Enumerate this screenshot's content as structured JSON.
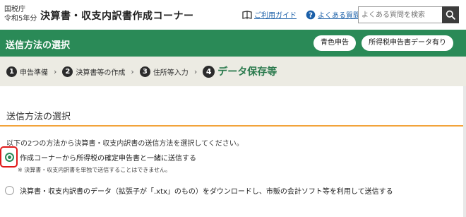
{
  "header": {
    "agency": "国税庁",
    "year": "令和5年分",
    "title": "決算書・収支内訳書作成コーナー",
    "guide_link": "ご利用ガイド",
    "faq_link": "よくある質問",
    "search_placeholder": "よくある質問を検索"
  },
  "green_bar": {
    "title": "送信方法の選択",
    "buttons": [
      "青色申告",
      "所得税申告書データ有り"
    ]
  },
  "steps": [
    {
      "num": "1",
      "label": "申告準備"
    },
    {
      "num": "2",
      "label": "決算書等の作成"
    },
    {
      "num": "3",
      "label": "住所等入力"
    },
    {
      "num": "4",
      "label": "データ保存等"
    }
  ],
  "main": {
    "heading": "送信方法の選択",
    "instruction": "以下の2つの方法から決算書・収支内訳書の送信方法を選択してください。",
    "options": [
      {
        "label": "作成コーナーから所得税の確定申告書と一緒に送信する",
        "selected": true
      },
      {
        "label": "決算書・収支内訳書のデータ（拡張子が「.xtx」のもの）をダウンロードし、市販の会計ソフト等を利用して送信する",
        "selected": false
      }
    ],
    "note": "※ 決算書・収支内訳書を単独で送信することはできません。"
  },
  "colors": {
    "brand_green": "#2a8a57",
    "accent_orange": "#f2a33a",
    "link_blue": "#1a5fa8",
    "highlight_red": "#e01a1a"
  }
}
